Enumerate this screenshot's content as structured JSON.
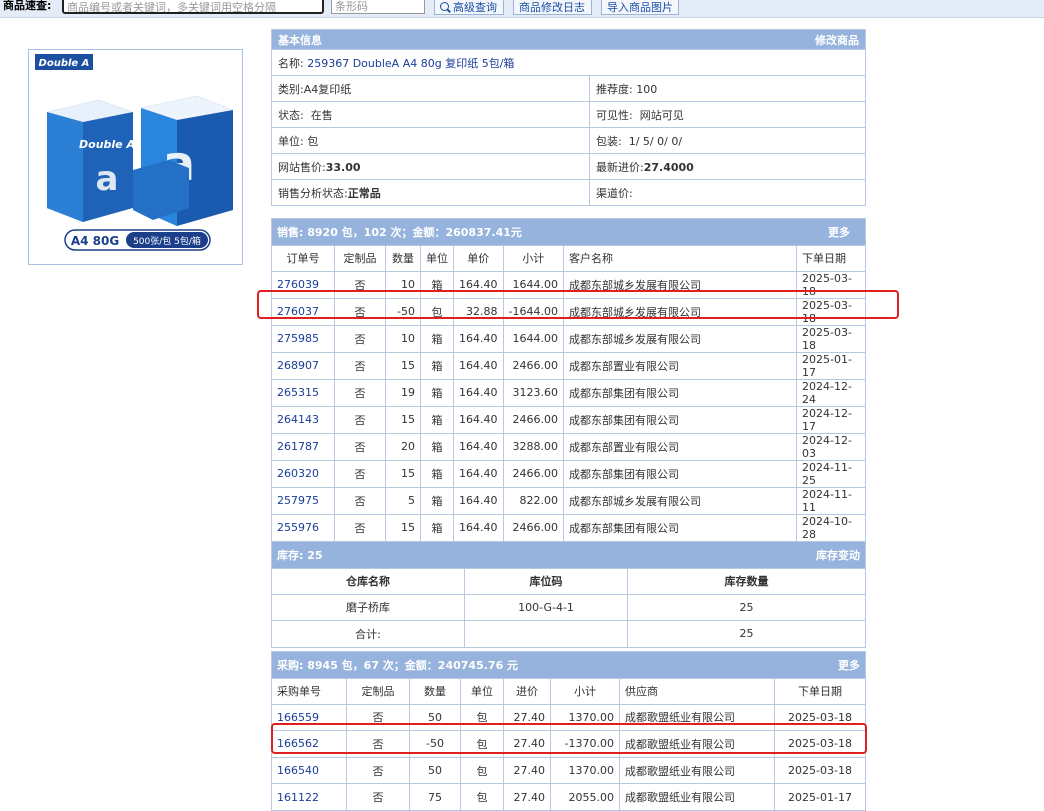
{
  "topbar": {
    "label": "商品速查:",
    "keyword_placeholder": "商品编号或者关键词，多关键词用空格分隔",
    "barcode_placeholder": "条形码",
    "buttons": [
      "高级查询",
      "商品修改日志",
      "导入商品图片"
    ]
  },
  "product_image": {
    "brand": "Double A",
    "caption": "A4 80G",
    "caption2": "500张/包 5包/箱"
  },
  "basic": {
    "title": "基本信息",
    "action": "修改商品",
    "name_label": "名称:",
    "name_value": "259367 DoubleA A4 80g 复印纸 5包/箱",
    "rows": [
      {
        "l_label": "类别:",
        "l_value": "A4复印纸",
        "r_label": "推荐度:",
        "r_value": "100"
      },
      {
        "l_label": "状态:",
        "l_value": "在售",
        "r_label": "可见性:",
        "r_value": "网站可见"
      },
      {
        "l_label": "单位:",
        "l_value": "包",
        "r_label": "包装:",
        "r_value": "1/ 5/ 0/ 0/"
      },
      {
        "l_label": "网站售价:",
        "l_value": "33.00",
        "r_label": "最新进价:",
        "r_value": "27.4000"
      },
      {
        "l_label": "销售分析状态:",
        "l_value": "正常品",
        "r_label": "渠道价:",
        "r_value": ""
      }
    ]
  },
  "sales": {
    "title": "销售:  8920 包，102 次；金额：260837.41元",
    "more": "更多",
    "headers": [
      "订单号",
      "定制品",
      "数量",
      "单位",
      "单价",
      "小计",
      "客户名称",
      "下单日期"
    ],
    "rows": [
      [
        "276039",
        "否",
        "10",
        "箱",
        "164.40",
        "1644.00",
        "成都东部城乡发展有限公司",
        "2025-03-18"
      ],
      [
        "276037",
        "否",
        "-50",
        "包",
        "32.88",
        "-1644.00",
        "成都东部城乡发展有限公司",
        "2025-03-18"
      ],
      [
        "275985",
        "否",
        "10",
        "箱",
        "164.40",
        "1644.00",
        "成都东部城乡发展有限公司",
        "2025-03-18"
      ],
      [
        "268907",
        "否",
        "15",
        "箱",
        "164.40",
        "2466.00",
        "成都东部置业有限公司",
        "2025-01-17"
      ],
      [
        "265315",
        "否",
        "19",
        "箱",
        "164.40",
        "3123.60",
        "成都东部集团有限公司",
        "2024-12-24"
      ],
      [
        "264143",
        "否",
        "15",
        "箱",
        "164.40",
        "2466.00",
        "成都东部集团有限公司",
        "2024-12-17"
      ],
      [
        "261787",
        "否",
        "20",
        "箱",
        "164.40",
        "3288.00",
        "成都东部置业有限公司",
        "2024-12-03"
      ],
      [
        "260320",
        "否",
        "15",
        "箱",
        "164.40",
        "2466.00",
        "成都东部集团有限公司",
        "2024-11-25"
      ],
      [
        "257975",
        "否",
        "5",
        "箱",
        "164.40",
        "822.00",
        "成都东部城乡发展有限公司",
        "2024-11-11"
      ],
      [
        "255976",
        "否",
        "15",
        "箱",
        "164.40",
        "2466.00",
        "成都东部集团有限公司",
        "2024-10-28"
      ]
    ]
  },
  "stock": {
    "title": "库存:  25",
    "action": "库存变动",
    "headers": [
      "仓库名称",
      "库位码",
      "库存数量"
    ],
    "rows": [
      [
        "磨子桥库",
        "100-G-4-1",
        "25"
      ]
    ],
    "total_label": "合计:",
    "total_value": "25"
  },
  "purchase": {
    "title": "采购:  8945 包，67 次；金额：240745.76 元",
    "more": "更多",
    "headers": [
      "采购单号",
      "定制品",
      "数量",
      "单位",
      "进价",
      "小计",
      "供应商",
      "下单日期"
    ],
    "rows": [
      [
        "166559",
        "否",
        "50",
        "包",
        "27.40",
        "1370.00",
        "成都歌盟纸业有限公司",
        "2025-03-18"
      ],
      [
        "166562",
        "否",
        "-50",
        "包",
        "27.40",
        "-1370.00",
        "成都歌盟纸业有限公司",
        "2025-03-18"
      ],
      [
        "166540",
        "否",
        "50",
        "包",
        "27.40",
        "1370.00",
        "成都歌盟纸业有限公司",
        "2025-03-18"
      ],
      [
        "161122",
        "否",
        "75",
        "包",
        "27.40",
        "2055.00",
        "成都歌盟纸业有限公司",
        "2025-01-17"
      ]
    ]
  },
  "colors": {
    "header_bg": "#96b3dd",
    "link": "#1a3d99",
    "highlight": "#e02020"
  }
}
